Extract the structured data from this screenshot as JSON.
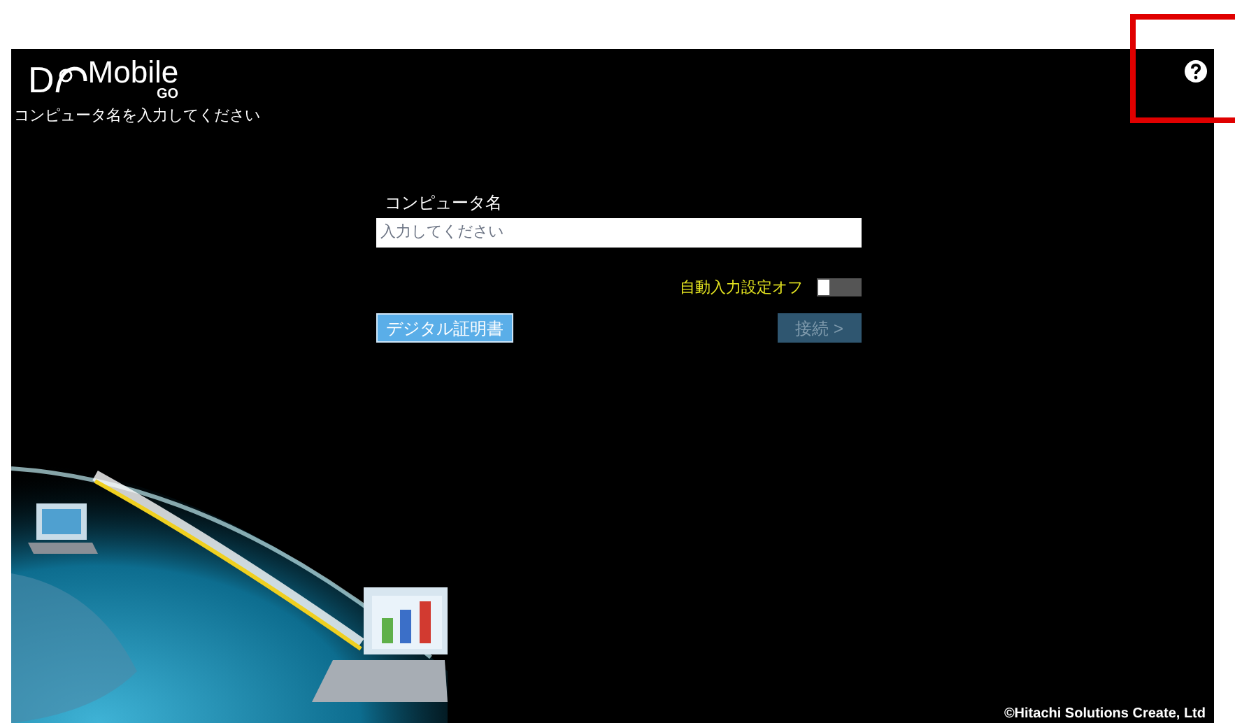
{
  "logo": {
    "letter": "D",
    "word": "Mobile",
    "sub": "GO"
  },
  "subtitle": "コンピュータ名を入力してください",
  "form": {
    "label": "コンピュータ名",
    "placeholder": "入力してください"
  },
  "auto_input": {
    "label": "自動入力設定オフ",
    "on": false
  },
  "buttons": [
    {
      "label": "デジタル証明書",
      "disabled": false
    },
    {
      "label": "接続 >",
      "disabled": true
    }
  ],
  "copyright": "©Hitachi Solutions Create, Ltd",
  "highlight": true
}
